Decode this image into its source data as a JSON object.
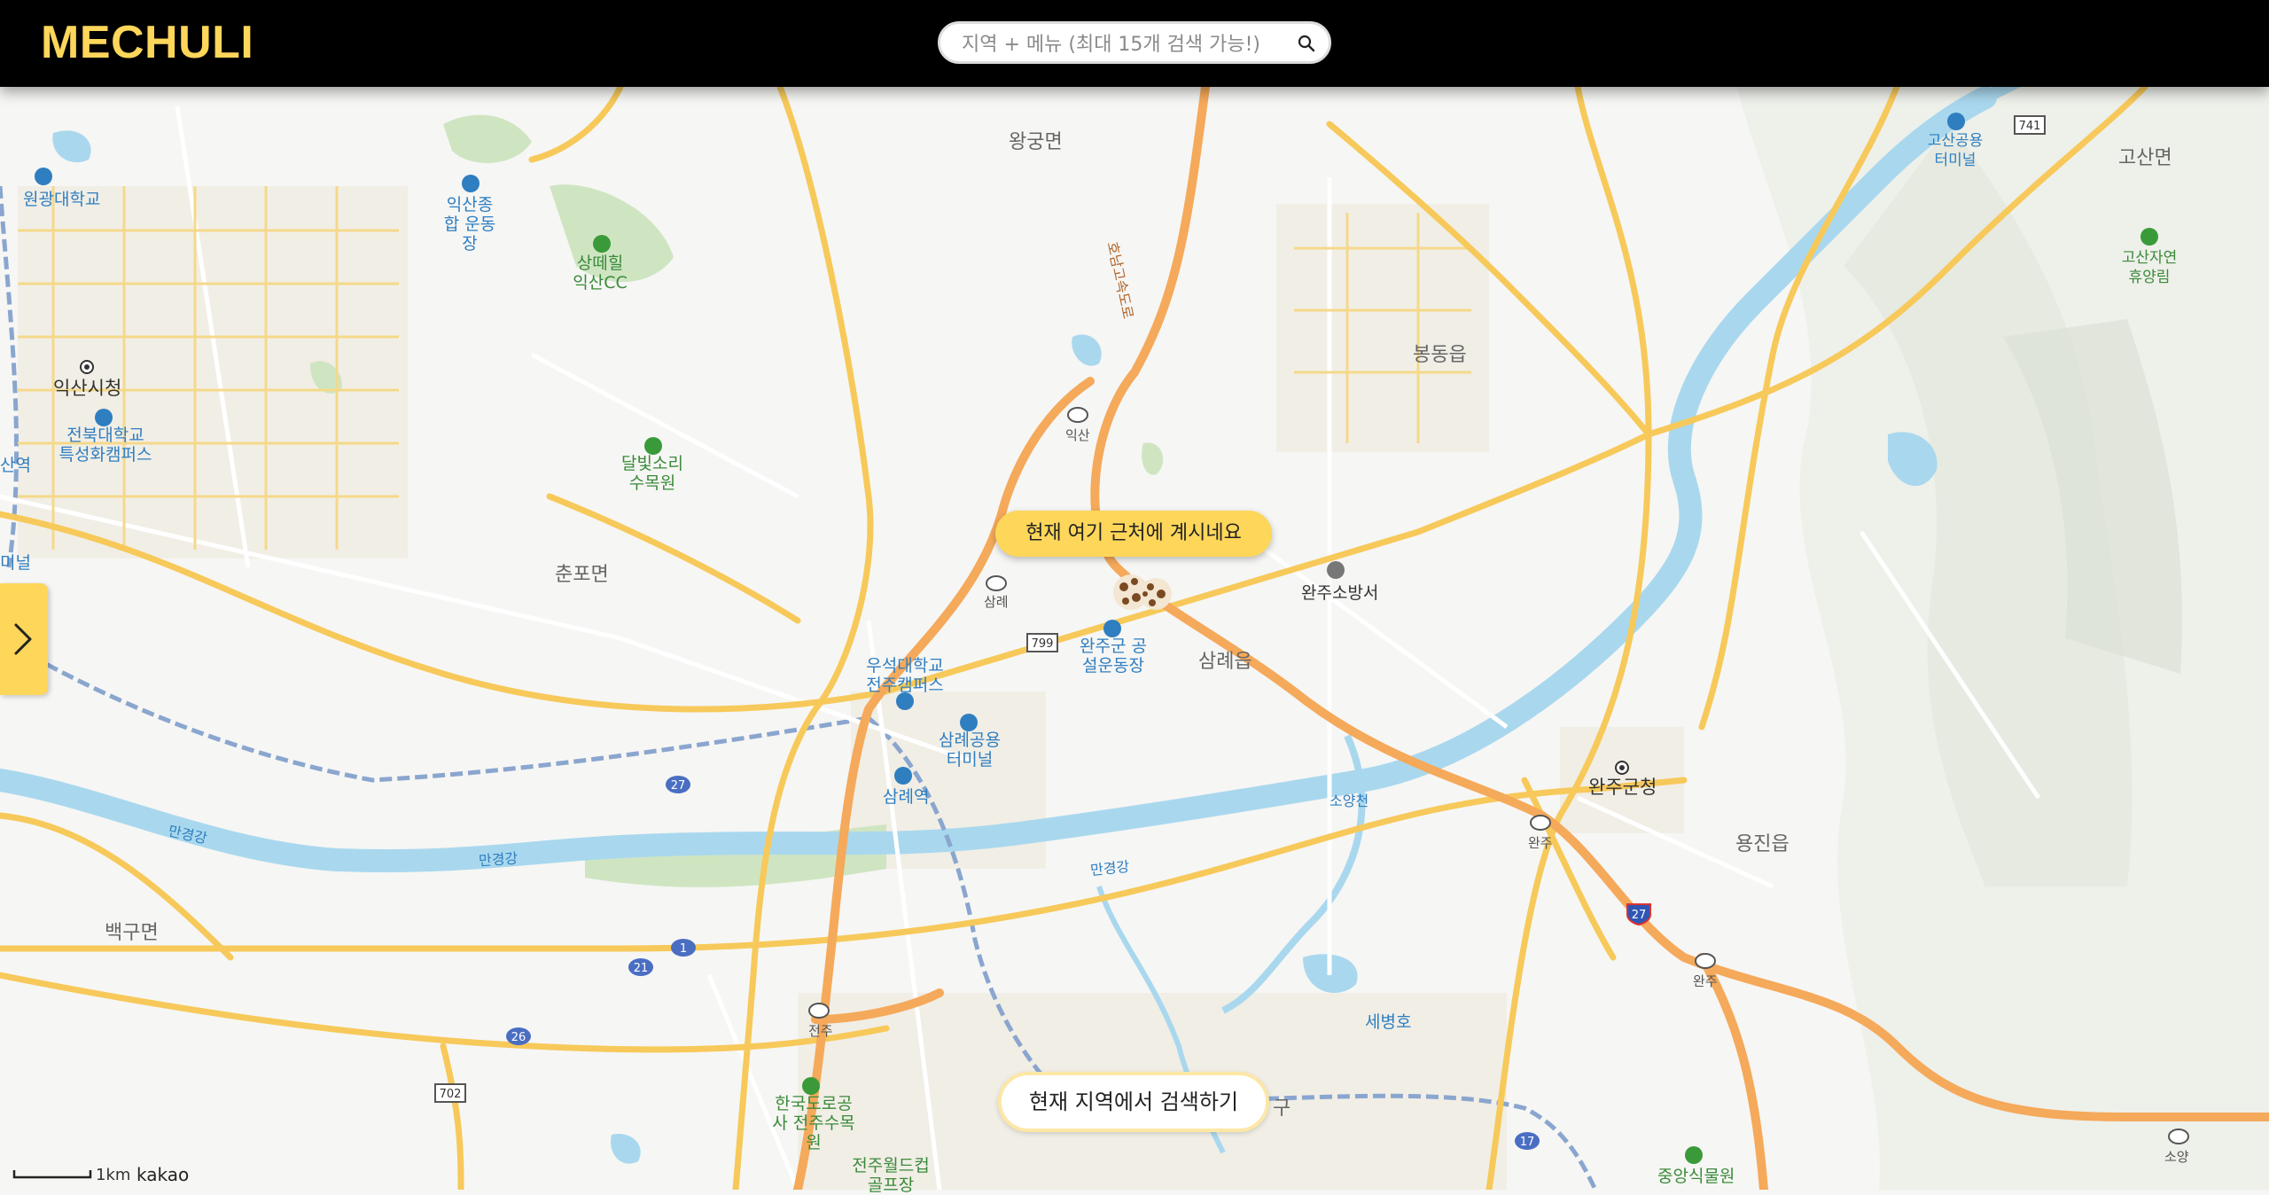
{
  "app": {
    "brand": "MECHULI"
  },
  "search": {
    "placeholder": "지역 + 메뉴 (최대 15개 검색 가능!)"
  },
  "map": {
    "current_location_bubble": "현재 여기 근처에 계시네요",
    "search_here_button": "현재 지역에서 검색하기",
    "scale_label": "1km",
    "provider": "kakao",
    "place_labels": [
      {
        "id": "wanggung",
        "text": "왕궁면",
        "kind": "district"
      },
      {
        "id": "gosan",
        "text": "고산면",
        "kind": "district"
      },
      {
        "id": "bongdong",
        "text": "봉동읍",
        "kind": "district"
      },
      {
        "id": "chunpo",
        "text": "춘포면",
        "kind": "district"
      },
      {
        "id": "samnye",
        "text": "삼례읍",
        "kind": "district"
      },
      {
        "id": "yongjin",
        "text": "용진읍",
        "kind": "district"
      },
      {
        "id": "baekgu",
        "text": "백구면",
        "kind": "district"
      },
      {
        "id": "iksan-cityhall",
        "text": "익산시청",
        "kind": "office"
      },
      {
        "id": "wanju-gunhall",
        "text": "완주군청",
        "kind": "office"
      },
      {
        "id": "wonkwang",
        "text": "원광대학교",
        "kind": "poi-blue"
      },
      {
        "id": "iksan-stadium",
        "text": "익산종합 운동장",
        "kind": "poi-blue"
      },
      {
        "id": "sangtaehill",
        "text": "상떼힐 익산CC",
        "kind": "poi-green"
      },
      {
        "id": "jbnu-special",
        "text": "전북대학교 특성화캠퍼스",
        "kind": "poi-blue"
      },
      {
        "id": "dalbit",
        "text": "달빛소리 수목원",
        "kind": "poi-green"
      },
      {
        "id": "woosuk",
        "text": "우석대학교 전주캠퍼스",
        "kind": "poi-blue"
      },
      {
        "id": "samnye-terminal",
        "text": "삼례공용 터미널",
        "kind": "poi-blue"
      },
      {
        "id": "samnye-station",
        "text": "삼례역",
        "kind": "poi-blue"
      },
      {
        "id": "wanju-stadium",
        "text": "완주군 공설운동장",
        "kind": "poi-blue"
      },
      {
        "id": "wanju-fire",
        "text": "완주소방서",
        "kind": "poi-dark"
      },
      {
        "id": "gosan-terminal",
        "text": "고산공용 터미널",
        "kind": "poi-blue"
      },
      {
        "id": "gosan-forest",
        "text": "고산자연 휴양림",
        "kind": "poi-green"
      },
      {
        "id": "sebyeongho",
        "text": "세병호",
        "kind": "poi-blue"
      },
      {
        "id": "ex-arboretum",
        "text": "한국도로공사 전주수목원",
        "kind": "poi-green"
      },
      {
        "id": "worldcup-golf",
        "text": "전주월드컵 골프장",
        "kind": "poi-green"
      },
      {
        "id": "central-garden",
        "text": "중앙식물원",
        "kind": "poi-green"
      },
      {
        "id": "soyangcheon",
        "text": "소양천",
        "kind": "river"
      },
      {
        "id": "mangyeong-1",
        "text": "만경강",
        "kind": "river"
      },
      {
        "id": "mangyeong-2",
        "text": "만경강",
        "kind": "river"
      },
      {
        "id": "mangyeong-3",
        "text": "만경강",
        "kind": "river"
      },
      {
        "id": "expressway",
        "text": "호남고속도로",
        "kind": "road"
      },
      {
        "id": "ic-iksan-jc",
        "text": "익산",
        "kind": "ic"
      },
      {
        "id": "ic-samnye",
        "text": "삼례",
        "kind": "ic"
      },
      {
        "id": "ic-wanju",
        "text": "완주",
        "kind": "ic"
      },
      {
        "id": "ic-wanju-jc",
        "text": "완주",
        "kind": "ic"
      },
      {
        "id": "ic-jeonju",
        "text": "전주",
        "kind": "ic"
      },
      {
        "id": "ic-soyang",
        "text": "소양",
        "kind": "ic"
      },
      {
        "id": "frag-gu",
        "text": "구",
        "kind": "district"
      },
      {
        "id": "frag-san",
        "text": "산역",
        "kind": "poi-blue"
      },
      {
        "id": "frag-mi",
        "text": "미널",
        "kind": "poi-blue"
      }
    ],
    "route_shields": [
      {
        "id": "r741",
        "text": "741",
        "kind": "local"
      },
      {
        "id": "r799",
        "text": "799",
        "kind": "local"
      },
      {
        "id": "r702",
        "text": "702",
        "kind": "local"
      },
      {
        "id": "r27a",
        "text": "27",
        "kind": "national"
      },
      {
        "id": "r27b",
        "text": "27",
        "kind": "expressway"
      },
      {
        "id": "r1",
        "text": "1",
        "kind": "national"
      },
      {
        "id": "r21",
        "text": "21",
        "kind": "national"
      },
      {
        "id": "r26",
        "text": "26",
        "kind": "national"
      },
      {
        "id": "r17",
        "text": "17",
        "kind": "national"
      }
    ]
  },
  "colors": {
    "brand_yellow": "#fdd65a",
    "topbar": "#000000",
    "water": "#a9d8ee",
    "road_major": "#f7c95a",
    "expressway": "#f5a95a"
  }
}
